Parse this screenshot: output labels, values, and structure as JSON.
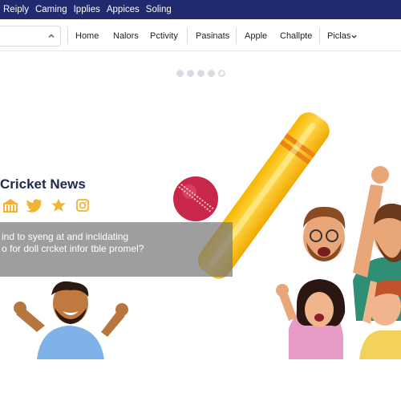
{
  "topbar": {
    "links": [
      "Reiply",
      "Caming",
      "Ipplies",
      "Appices",
      "Soling"
    ]
  },
  "nav": {
    "items": [
      "Home",
      "Nalors",
      "Pctivity",
      "Pasinats",
      "Apple",
      "Challpte",
      "Piclas"
    ]
  },
  "hero": {
    "title": "Cricket News",
    "banner_line1": "ind to syeng at and inclidating",
    "banner_line2": "o for doll crcket infor tble promel?"
  },
  "colors": {
    "topbar": "#1f2b6e",
    "bat": "#f5c21b",
    "ball": "#c8264a"
  },
  "icons": [
    "chevron-up-icon",
    "building-icon",
    "twitter-icon",
    "star-icon",
    "instagram-icon",
    "chevron-down-icon"
  ]
}
